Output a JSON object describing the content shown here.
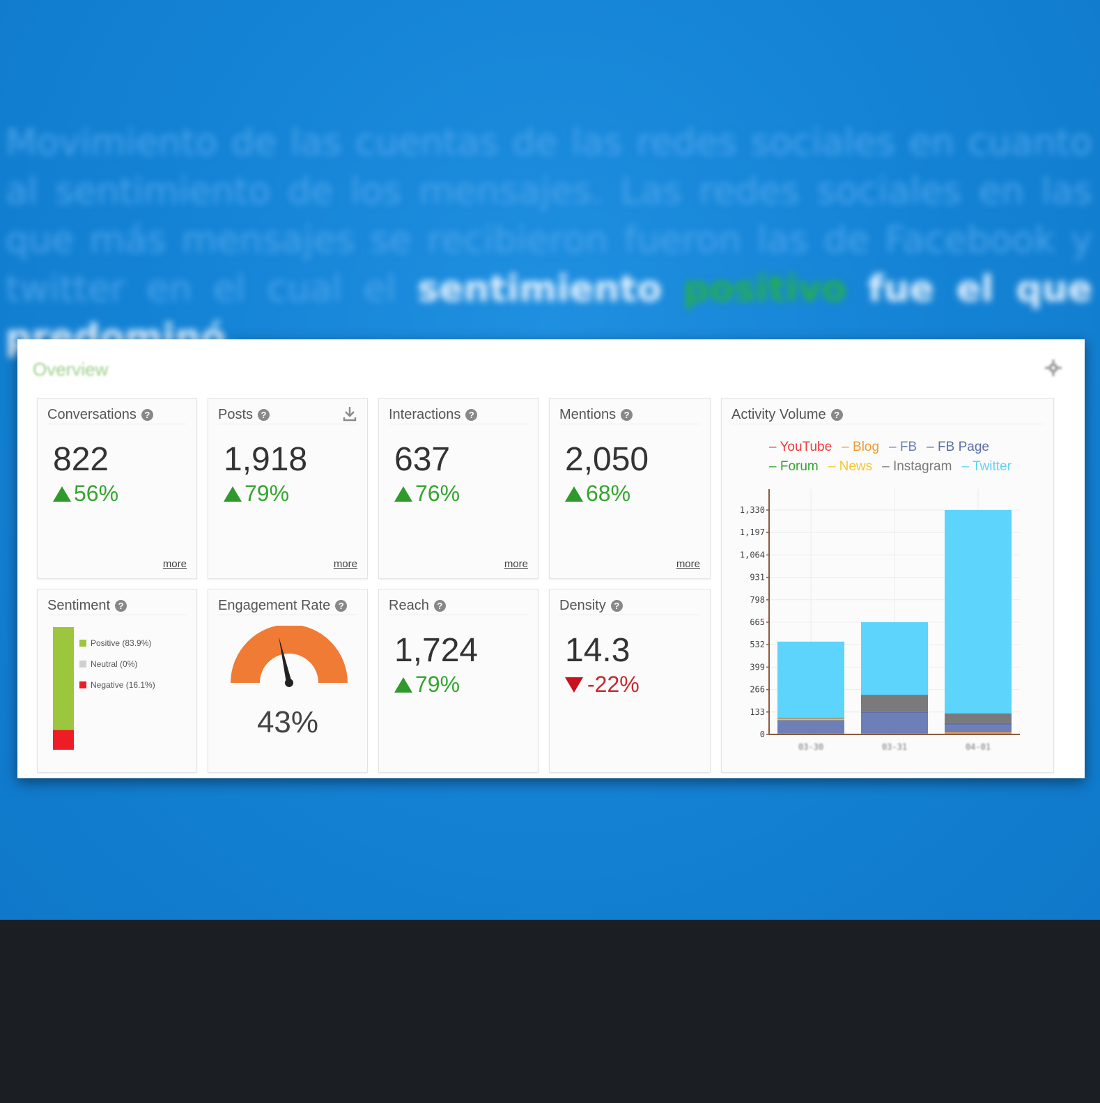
{
  "caption": {
    "line1": "Movimiento de las cuentas de las redes sociales en cuanto al",
    "line2": "sentimiento de los mensajes. Las redes sociales en las que",
    "line3": "más mensajes se recibieron fueron las de Facebook y twitter",
    "line4_pre": "en el cual el",
    "line4_strong": "sentimiento",
    "line4_green": "positivo",
    "line4_post": "fue el que predominó."
  },
  "panel": {
    "title": "Overview"
  },
  "metrics": [
    {
      "title": "Conversations",
      "value": "822",
      "delta": "56%",
      "trend": "up",
      "more": "more"
    },
    {
      "title": "Posts",
      "value": "1,918",
      "delta": "79%",
      "trend": "up",
      "more": "more"
    },
    {
      "title": "Interactions",
      "value": "637",
      "delta": "76%",
      "trend": "up",
      "more": "more"
    },
    {
      "title": "Mentions",
      "value": "2,050",
      "delta": "68%",
      "trend": "up",
      "more": "more"
    },
    {
      "title": "Reach",
      "value": "1,724",
      "delta": "79%",
      "trend": "up"
    },
    {
      "title": "Density",
      "value": "14.3",
      "delta": "-22%",
      "trend": "down"
    }
  ],
  "sentiment": {
    "title": "Sentiment",
    "items": [
      {
        "label": "Positive (83.9%)",
        "value": 83.9,
        "color": "#9dc63f"
      },
      {
        "label": "Neutral (0%)",
        "value": 0,
        "color": "#cfcfcf"
      },
      {
        "label": "Negative (16.1%)",
        "value": 16.1,
        "color": "#ee1c24"
      }
    ]
  },
  "engagement": {
    "title": "Engagement Rate",
    "value": "43%",
    "level": 0.43,
    "color": "#f07b35"
  },
  "activity": {
    "title": "Activity Volume",
    "chart_data": {
      "type": "bar",
      "stacked": true,
      "categories": [
        "03-30",
        "03-31",
        "04-01"
      ],
      "yticks": [
        "0",
        "133",
        "266",
        "399",
        "532",
        "665",
        "798",
        "931",
        "1,064",
        "1,197",
        "1,330"
      ],
      "ylim": [
        0,
        1330
      ],
      "grid": true,
      "legend_position": "top",
      "series": [
        {
          "name": "YouTube",
          "color": "#ee3b3b",
          "values": [
            0,
            0,
            0
          ]
        },
        {
          "name": "Blog",
          "color": "#f39a2e",
          "values": [
            5,
            5,
            12
          ]
        },
        {
          "name": "FB",
          "color": "#6d7fb6",
          "values": [
            75,
            120,
            45
          ]
        },
        {
          "name": "FB Page",
          "color": "#5b6ea8",
          "values": [
            5,
            10,
            12
          ]
        },
        {
          "name": "Forum",
          "color": "#34a52f",
          "values": [
            0,
            0,
            0
          ]
        },
        {
          "name": "News",
          "color": "#f7c52d",
          "values": [
            8,
            0,
            0
          ]
        },
        {
          "name": "Instagram",
          "color": "#7a7a7a",
          "values": [
            5,
            100,
            55
          ]
        },
        {
          "name": "Twitter",
          "color": "#5cd4fb",
          "values": [
            452,
            430,
            1206
          ]
        }
      ]
    }
  }
}
